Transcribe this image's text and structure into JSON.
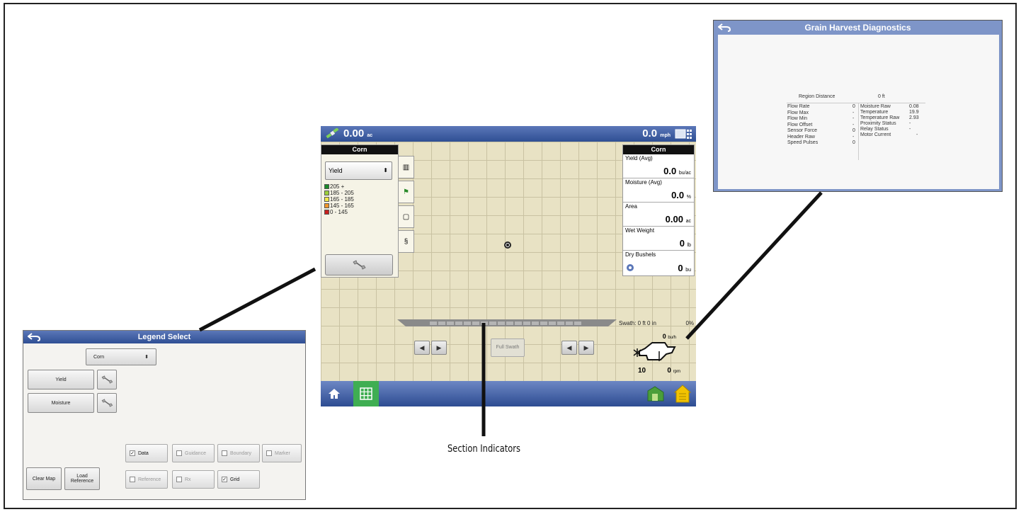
{
  "main": {
    "top_left_value": "0.00",
    "top_left_unit": "ac",
    "top_right_value": "0.0",
    "top_right_unit": "mph",
    "legend_panel": {
      "header": "Corn",
      "select_value": "Yield",
      "ranges": [
        {
          "label": "205 +",
          "color": "#1a8a2a"
        },
        {
          "label": "185 - 205",
          "color": "#9bcf3a"
        },
        {
          "label": "165 - 185",
          "color": "#f2e84a"
        },
        {
          "label": "145 - 165",
          "color": "#f0962a"
        },
        {
          "label": "0 - 145",
          "color": "#c8201e"
        }
      ]
    },
    "right_panel": {
      "header": "Corn",
      "items": [
        {
          "label": "Yield (Avg)",
          "value": "0.0",
          "unit": "bu/ac"
        },
        {
          "label": "Moisture (Avg)",
          "value": "0.0",
          "unit": "%"
        },
        {
          "label": "Area",
          "value": "0.00",
          "unit": "ac"
        },
        {
          "label": "Wet Weight",
          "value": "0",
          "unit": "lb"
        },
        {
          "label": "Dry Bushels",
          "value": "0",
          "unit": "bu"
        }
      ]
    },
    "swath": "Swath: 0 ft 0 in",
    "swath_pct": "0%",
    "full_swath": "Full Swath",
    "flow_value": "0",
    "flow_unit": "bu/h",
    "header_value": "10",
    "rpm_value": "0",
    "rpm_unit": "rpm"
  },
  "legend_select": {
    "title": "Legend Select",
    "crop": "Corn",
    "yield_label": "Yield",
    "moisture_label": "Moisture",
    "checkboxes": {
      "data": "Data",
      "guidance": "Guidance",
      "boundary": "Boundary",
      "marker": "Marker",
      "reference": "Reference",
      "rx": "Rx",
      "grid": "Grid"
    },
    "clear_map": "Clear Map",
    "load_reference": "Load Reference"
  },
  "diagnostics": {
    "title": "Grain Harvest Diagnostics",
    "region_distance_label": "Region Distance",
    "region_distance_value": "0 ft",
    "left": [
      {
        "label": "Flow Rate",
        "value": "0"
      },
      {
        "label": "Flow Max",
        "value": "-"
      },
      {
        "label": "Flow Min",
        "value": "-"
      },
      {
        "label": "Flow Offset",
        "value": "-"
      },
      {
        "label": "Sensor Force",
        "value": "0"
      },
      {
        "label": "Header Raw",
        "value": "-"
      },
      {
        "label": "Speed Pulses",
        "value": "0"
      }
    ],
    "right": [
      {
        "label": "Moisture Raw",
        "value": "0.08"
      },
      {
        "label": "Temperature",
        "value": "19.9"
      },
      {
        "label": "Temperature Raw",
        "value": "2.93"
      },
      {
        "label": "Proximity Status",
        "value": "-"
      },
      {
        "label": "Relay Status",
        "value": "-"
      },
      {
        "label": "Motor Current",
        "value": "-"
      }
    ]
  },
  "caption": "Section Indicators",
  "colors": {
    "bar_blue": "#2f4f94",
    "map_tan": "#e8e2c4",
    "grid_green": "#3fae52"
  }
}
